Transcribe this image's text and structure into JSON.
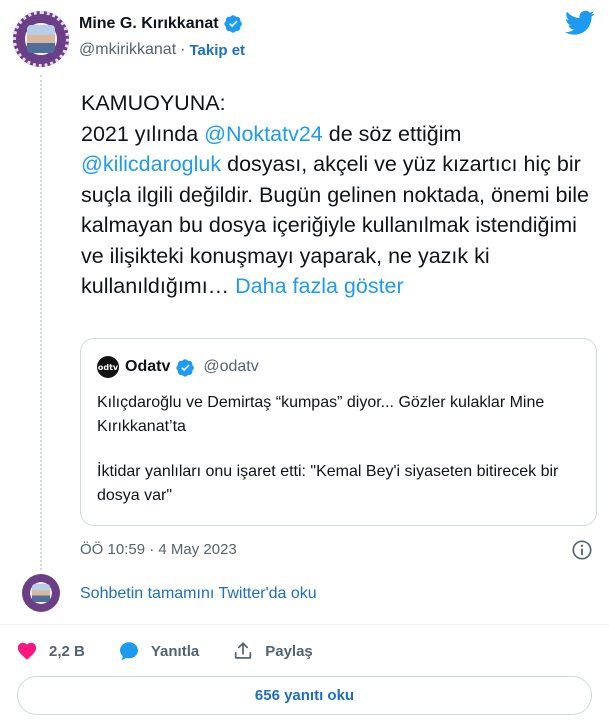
{
  "author": {
    "name": "Mine G. Kırıkkanat",
    "handle": "@mkirikkanat",
    "separator": "·",
    "follow_label": "Takip et"
  },
  "tweet": {
    "line1": "KAMUOYUNA:",
    "t1": "2021 yılında ",
    "mention1": "@Noktatv24",
    "t2": " de söz ettiğim ",
    "mention2": "@kilicdarogluk",
    "t3": " dosyası, akçeli ve yüz kızartıcı hiç bir suçla ilgili değildir. Bugün gelinen noktada, önemi bile kalmayan bu dosya içeriğiyle kullanılmak istendiğimi ve ilişikteki konuşmayı yaparak, ne yazık ki kullanıldığımı…",
    "more_label": "Daha fazla göster"
  },
  "quote": {
    "logo_text": "odtv",
    "name": "Odatv",
    "handle": "@odatv",
    "paragraph1": "Kılıçdaroğlu ve Demirtaş “kumpas” diyor... Gözler kulaklar Mine Kırıkkanat’ta",
    "paragraph2": "İktidar yanlıları onu işaret etti: \"Kemal Bey'i siyaseten bitirecek bir dosya var\""
  },
  "timestamp": "ÖÖ 10:59 · 4 May 2023",
  "read_thread_label": "Sohbetin tamamını Twitter'da oku",
  "actions": {
    "like_count": "2,2 B",
    "reply_label": "Yanıtla",
    "share_label": "Paylaş"
  },
  "replies_button_label": "656 yanıtı oku",
  "colors": {
    "accent": "#1d9bf0",
    "link": "#1d6fbf",
    "like": "#f91880",
    "muted": "#536471"
  },
  "icons": [
    "twitter-bird-icon",
    "verified-badge-icon",
    "info-icon",
    "heart-icon",
    "reply-bubble-icon",
    "share-icon"
  ]
}
